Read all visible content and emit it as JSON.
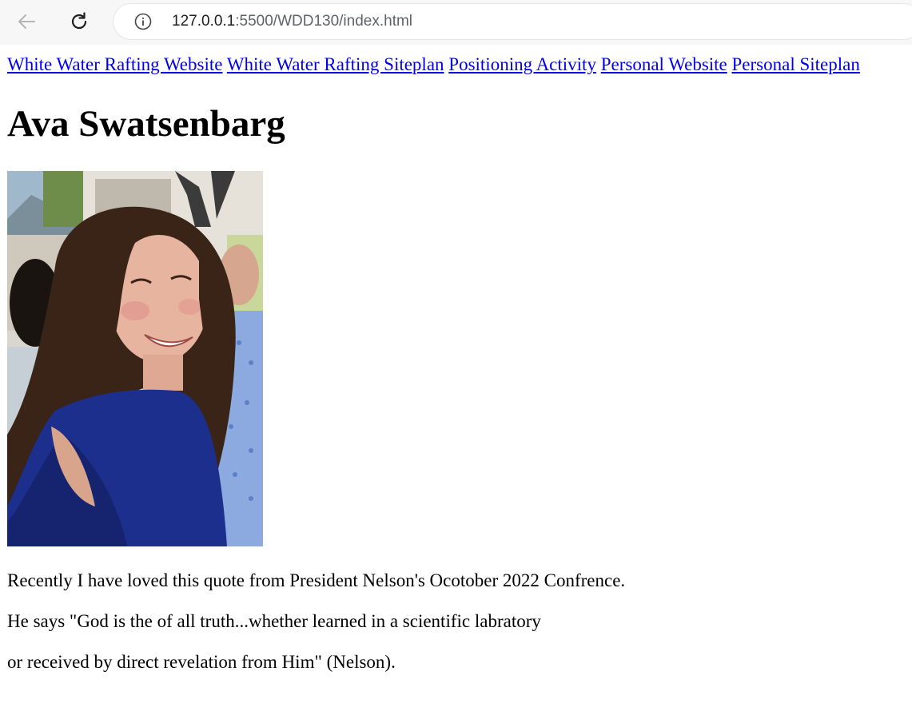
{
  "browser": {
    "url_host": "127.0.0.1",
    "url_rest": ":5500/WDD130/index.html",
    "back_icon": "arrow-left-icon",
    "reload_icon": "reload-icon",
    "info_icon": "info-circle-icon"
  },
  "nav": {
    "links": [
      {
        "label": "White Water Rafting Website"
      },
      {
        "label": "White Water Rafting Siteplan"
      },
      {
        "label": "Positioning Activity"
      },
      {
        "label": "Personal Website"
      },
      {
        "label": "Personal Siteplan"
      }
    ],
    "link_color": "#0000ee"
  },
  "main": {
    "title": "Ava Swatsenbarg",
    "paragraphs": [
      "Recently I have loved this quote from President Nelson's Ocotober 2022 Confrence.",
      "He says \"God is the of all truth...whether learned in a scientific labratory",
      "or received by direct revelation from Him\" (Nelson)."
    ]
  }
}
